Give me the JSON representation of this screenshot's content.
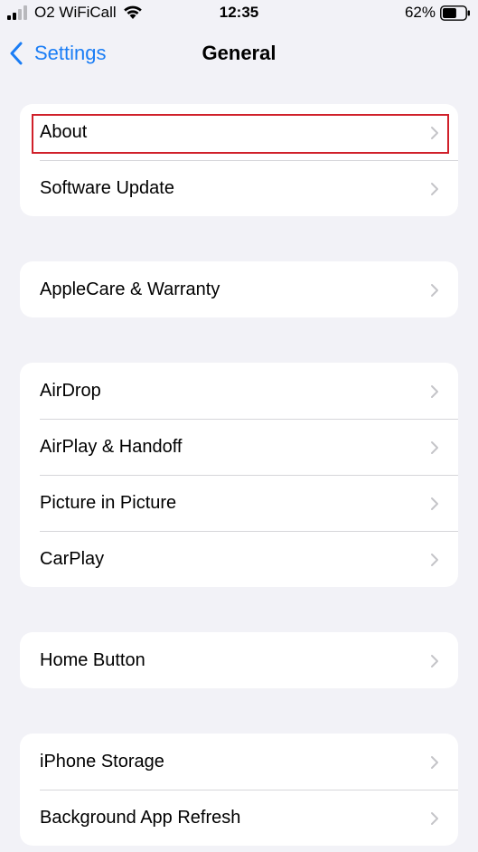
{
  "status_bar": {
    "carrier": "O2 WiFiCall",
    "time": "12:35",
    "battery_percent": "62%",
    "battery_level": 0.62
  },
  "nav": {
    "back_label": "Settings",
    "title": "General"
  },
  "groups": [
    {
      "rows": [
        {
          "label": "About",
          "highlighted": true
        },
        {
          "label": "Software Update"
        }
      ]
    },
    {
      "rows": [
        {
          "label": "AppleCare & Warranty"
        }
      ]
    },
    {
      "rows": [
        {
          "label": "AirDrop"
        },
        {
          "label": "AirPlay & Handoff"
        },
        {
          "label": "Picture in Picture"
        },
        {
          "label": "CarPlay"
        }
      ]
    },
    {
      "rows": [
        {
          "label": "Home Button"
        }
      ]
    },
    {
      "rows": [
        {
          "label": "iPhone Storage"
        },
        {
          "label": "Background App Refresh"
        }
      ]
    }
  ],
  "colors": {
    "accent": "#1a7df5",
    "highlight_border": "#d0202a",
    "background": "#f2f2f7"
  }
}
